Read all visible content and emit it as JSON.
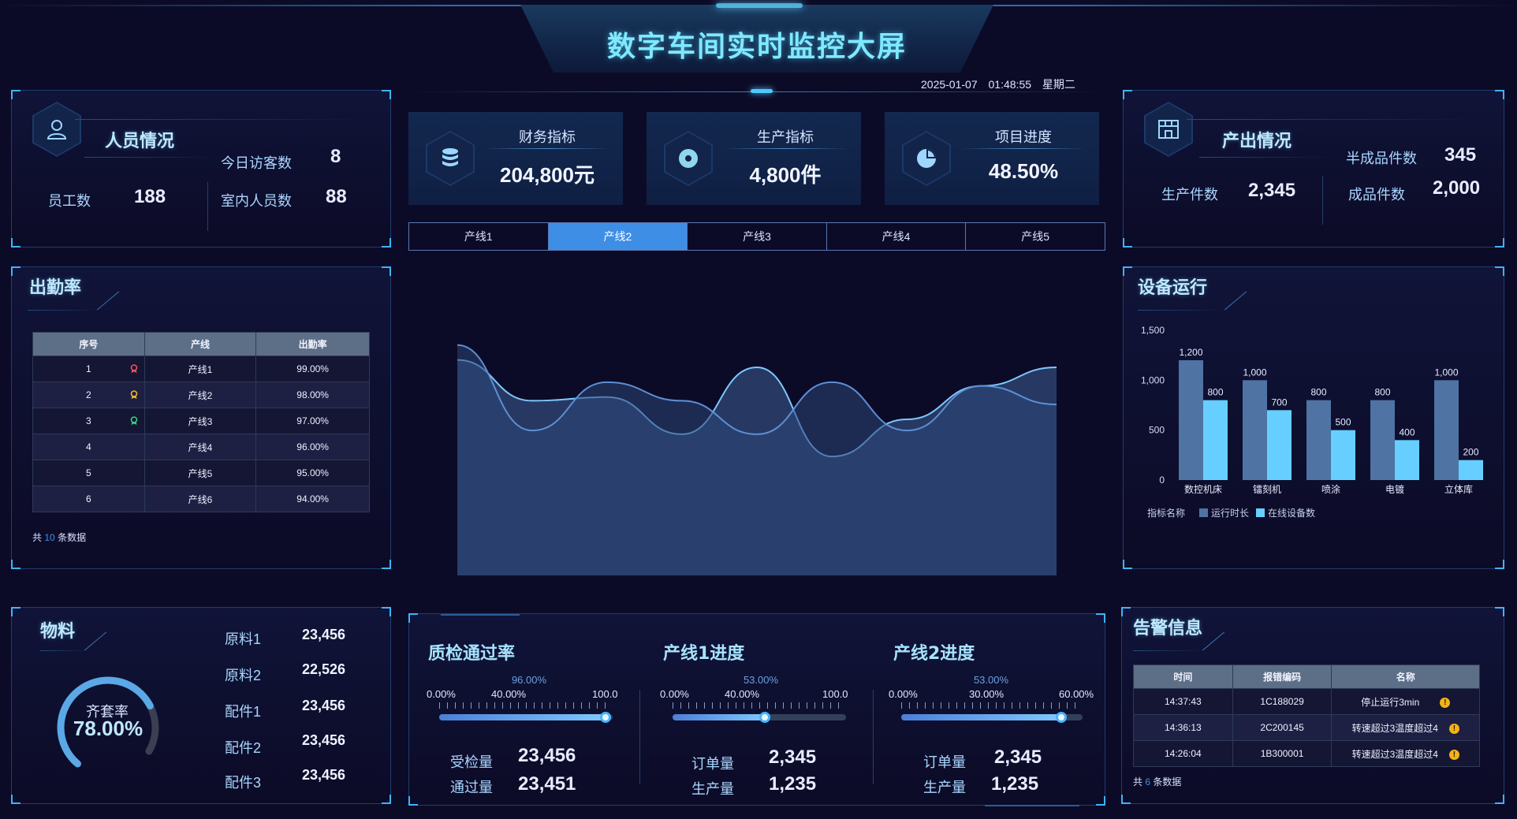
{
  "header": {
    "title": "数字车间实时监控大屏",
    "date": "2025-01-07",
    "time": "01:48:55",
    "weekday": "星期二"
  },
  "personnel": {
    "title": "人员情况",
    "today_visitors_label": "今日访客数",
    "today_visitors": "8",
    "staff_label": "员工数",
    "staff": "188",
    "indoor_label": "室内人员数",
    "indoor": "88"
  },
  "kpis": [
    {
      "title": "财务指标",
      "value": "204,800元",
      "icon": "database-icon"
    },
    {
      "title": "生产指标",
      "value": "4,800件",
      "icon": "target-icon"
    },
    {
      "title": "项目进度",
      "value": "48.50%",
      "icon": "pie-icon"
    }
  ],
  "tabs": [
    "产线1",
    "产线2",
    "产线3",
    "产线4",
    "产线5"
  ],
  "active_tab": 1,
  "output": {
    "title": "产出情况",
    "semi_label": "半成品件数",
    "semi": "345",
    "produced_label": "生产件数",
    "produced": "2,345",
    "finished_label": "成品件数",
    "finished": "2,000"
  },
  "attendance": {
    "title": "出勤率",
    "headers": [
      "序号",
      "产线",
      "出勤率"
    ],
    "rows": [
      {
        "no": "1",
        "line": "产线1",
        "rate": "99.00%",
        "medal": "red"
      },
      {
        "no": "2",
        "line": "产线2",
        "rate": "98.00%",
        "medal": "gold"
      },
      {
        "no": "3",
        "line": "产线3",
        "rate": "97.00%",
        "medal": "green"
      },
      {
        "no": "4",
        "line": "产线4",
        "rate": "96.00%",
        "medal": ""
      },
      {
        "no": "5",
        "line": "产线5",
        "rate": "95.00%",
        "medal": ""
      },
      {
        "no": "6",
        "line": "产线6",
        "rate": "94.00%",
        "medal": ""
      }
    ],
    "footer_prefix": "共",
    "footer_count": "10",
    "footer_suffix": "条数据"
  },
  "equipment": {
    "title": "设备运行",
    "legend_title": "指标名称",
    "colors": {
      "runtime": "#4f73a3",
      "online": "#66cfff"
    }
  },
  "materials": {
    "title": "物料",
    "gauge_label": "齐套率",
    "gauge_value": "78.00%",
    "gauge_fraction": 0.78,
    "items": [
      {
        "name": "原料1",
        "value": "23,456"
      },
      {
        "name": "原料2",
        "value": "22,526"
      },
      {
        "name": "配件1",
        "value": "23,456"
      },
      {
        "name": "配件2",
        "value": "23,456"
      },
      {
        "name": "配件3",
        "value": "23,456"
      }
    ]
  },
  "progress": [
    {
      "title": "质检通过率",
      "pct_label": "96.00%",
      "ticks": [
        "0.00%",
        "40.00%",
        "100.00%"
      ],
      "fraction": 0.96,
      "row1_label": "受检量",
      "row1_value": "23,456",
      "row2_label": "通过量",
      "row2_value": "23,451"
    },
    {
      "title": "产线1进度",
      "pct_label": "53.00%",
      "ticks": [
        "0.00%",
        "40.00%",
        "100.00%"
      ],
      "fraction": 0.53,
      "row1_label": "订单量",
      "row1_value": "2,345",
      "row2_label": "生产量",
      "row2_value": "1,235"
    },
    {
      "title": "产线2进度",
      "pct_label": "53.00%",
      "ticks": [
        "0.00%",
        "30.00%",
        "60.00%"
      ],
      "fraction": 0.883,
      "row1_label": "订单量",
      "row1_value": "2,345",
      "row2_label": "生产量",
      "row2_value": "1,235"
    }
  ],
  "alerts": {
    "title": "告警信息",
    "headers": [
      "时间",
      "报错编码",
      "名称"
    ],
    "rows": [
      {
        "time": "14:37:43",
        "code": "1C188029",
        "name": "停止运行3min"
      },
      {
        "time": "14:36:13",
        "code": "2C200145",
        "name": "转速超过3温度超过4"
      },
      {
        "time": "14:26:04",
        "code": "1B300001",
        "name": "转速超过3温度超过4"
      }
    ],
    "footer_prefix": "共",
    "footer_count": "6",
    "footer_suffix": "条数据"
  },
  "chart_data": [
    {
      "type": "area",
      "title": "",
      "x": [
        0,
        1,
        2,
        3,
        4,
        5,
        6,
        7,
        8
      ],
      "series": [
        {
          "values": [
            580,
            470,
            480,
            380,
            560,
            320,
            420,
            510,
            560
          ]
        },
        {
          "values": [
            620,
            390,
            520,
            470,
            380,
            520,
            390,
            510,
            460
          ]
        }
      ],
      "colors": [
        "#7ec8ff",
        "#5d8fd4"
      ]
    },
    {
      "type": "bar",
      "categories": [
        "数控机床",
        "镭刻机",
        "喷涂",
        "电镀",
        "立体库"
      ],
      "series": [
        {
          "name": "运行时长",
          "values": [
            1200,
            1000,
            800,
            800,
            1000
          ]
        },
        {
          "name": "在线设备数",
          "values": [
            800,
            700,
            500,
            400,
            200
          ]
        }
      ],
      "yticks": [
        "0",
        "500",
        "1,000",
        "1,500"
      ],
      "ylim": [
        0,
        1500
      ],
      "legend": "bottom-left"
    }
  ]
}
